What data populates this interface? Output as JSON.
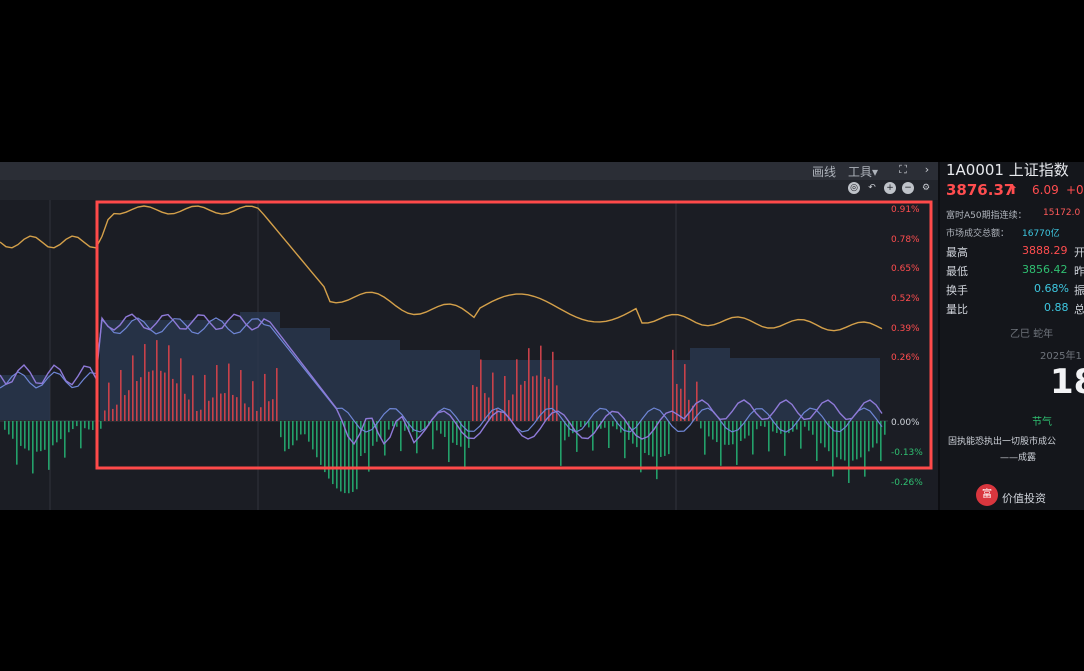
{
  "toolbar": {
    "line_label": "画线",
    "tools_label": "工具▾"
  },
  "chart": {
    "y_labels": [
      "0.91%",
      "0.78%",
      "0.65%",
      "0.52%",
      "0.39%",
      "0.26%",
      "0.00%",
      "-0.13%",
      "-0.26%"
    ],
    "colors": {
      "price_line": "#d4a04a",
      "volume_ratio_line": "#8f7ad8",
      "bar_up": "#c8414a",
      "bar_down": "#23a06a",
      "highlight_box": "#ff4a4a"
    }
  },
  "side": {
    "code_title": "1A0001 上证指数",
    "price": "3876.37",
    "change": "6.09",
    "change_pct": "+0",
    "a50_label": "富时A50期指连续：",
    "a50_value": "15172.0",
    "turnover_label": "市场成交总额：",
    "turnover_value": "16770亿",
    "rows": [
      {
        "label": "最高",
        "value": "3888.29",
        "suffix": "开"
      },
      {
        "label": "最低",
        "value": "3856.42",
        "suffix": "昨"
      },
      {
        "label": "换手",
        "value": "0.68%",
        "suffix": "振"
      },
      {
        "label": "量比",
        "value": "0.88",
        "suffix": "总"
      }
    ],
    "year_label": "乙巳 蛇年",
    "date_label": "2025年1",
    "big_number": "18",
    "note_label": "节气",
    "quote_text": "固执能恐执出一切股市成公",
    "quote_author": "——成露",
    "badge_text": "富",
    "value_invest": "价值投资"
  }
}
